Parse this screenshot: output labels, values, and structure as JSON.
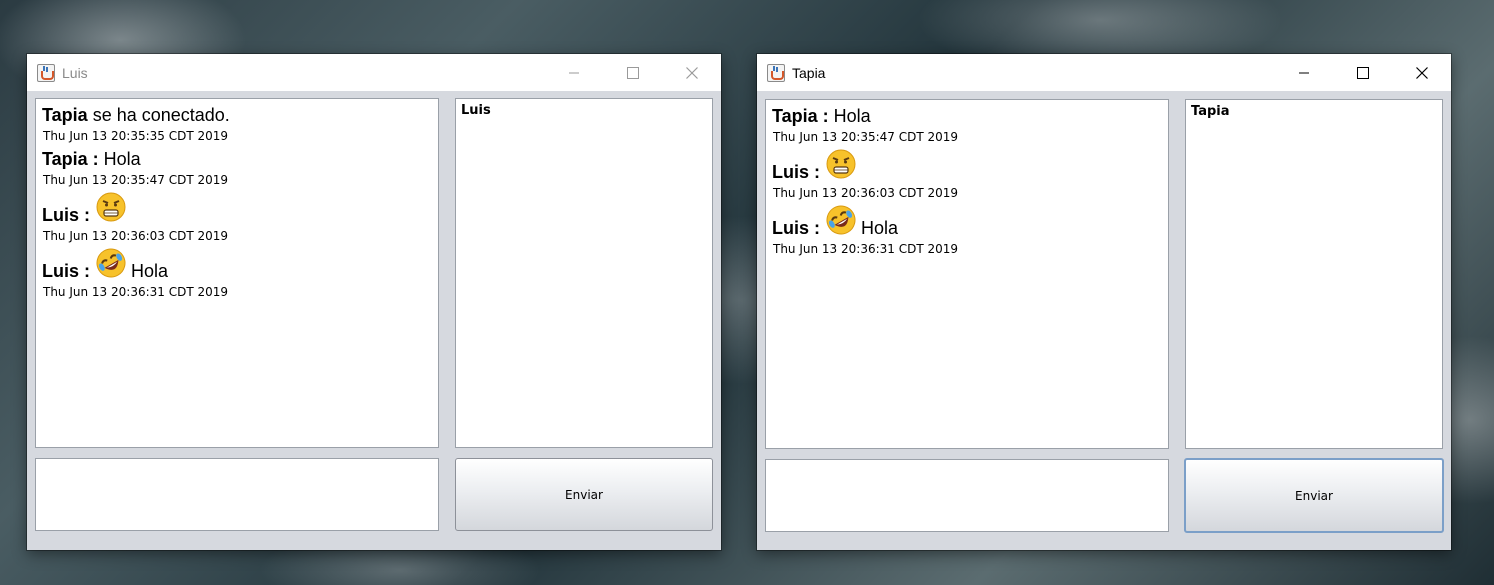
{
  "windows": [
    {
      "title": "Luis",
      "messages": [
        {
          "sender": "Tapia",
          "text": "se ha conectado.",
          "emoji": "",
          "time": "Thu Jun 13 20:35:35 CDT 2019"
        },
        {
          "sender": "Tapia :",
          "text": "Hola",
          "emoji": "",
          "time": "Thu Jun 13 20:35:47 CDT 2019"
        },
        {
          "sender": "Luis :",
          "text": "",
          "emoji": "angry-face-icon",
          "time": "Thu Jun 13 20:36:03 CDT 2019"
        },
        {
          "sender": "Luis :",
          "text": "Hola",
          "emoji": "rofl-face-icon",
          "time": "Thu Jun 13 20:36:31 CDT 2019"
        }
      ],
      "users": [
        "Luis"
      ],
      "message_input": "",
      "send_label": "Enviar"
    },
    {
      "title": "Tapia",
      "messages": [
        {
          "sender": "Tapia :",
          "text": "Hola",
          "emoji": "",
          "time": "Thu Jun 13 20:35:47 CDT 2019"
        },
        {
          "sender": "Luis :",
          "text": "",
          "emoji": "angry-face-icon",
          "time": "Thu Jun 13 20:36:03 CDT 2019"
        },
        {
          "sender": "Luis :",
          "text": "Hola",
          "emoji": "rofl-face-icon",
          "time": "Thu Jun 13 20:36:31 CDT 2019"
        }
      ],
      "users": [
        "Tapia"
      ],
      "message_input": "",
      "send_label": "Enviar"
    }
  ],
  "colors": {
    "panel_bg": "#d6d9df",
    "titlebar_bg": "#ffffff",
    "button_focus": "#7b9fc8"
  },
  "icons": {
    "app": "java-icon",
    "minimize": "minimize-icon",
    "maximize": "maximize-icon",
    "close": "close-icon"
  }
}
